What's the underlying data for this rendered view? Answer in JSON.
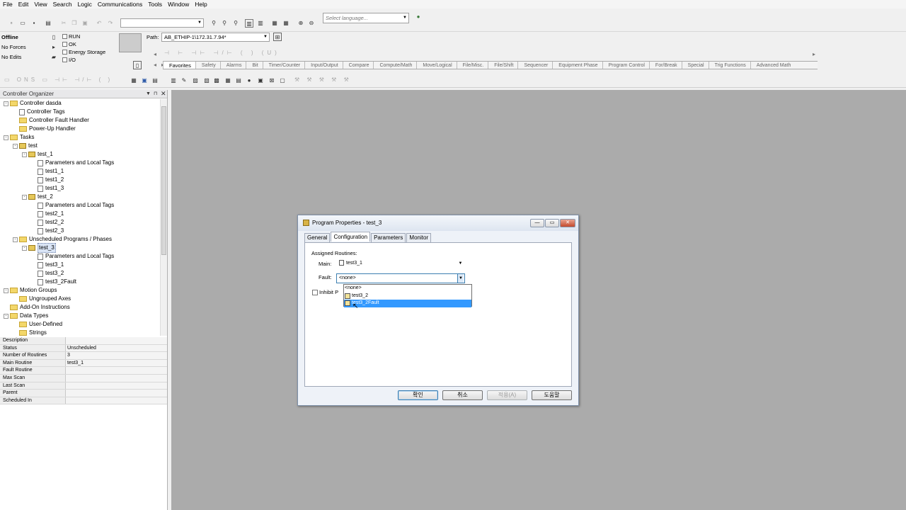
{
  "menu": [
    "File",
    "Edit",
    "View",
    "Search",
    "Logic",
    "Communications",
    "Tools",
    "Window",
    "Help"
  ],
  "toolbar": {
    "language_placeholder": "Select language...",
    "path_label": "Path:",
    "path_value": "AB_ETHIP-1\\172.31.7.94*"
  },
  "status": {
    "mode": "Offline",
    "forces": "No Forces",
    "edits": "No Edits",
    "indicators": [
      "RUN",
      "OK",
      "Energy Storage",
      "I/O"
    ]
  },
  "instruction_tabs": [
    "Favorites",
    "Safety",
    "Alarms",
    "Bit",
    "Timer/Counter",
    "Input/Output",
    "Compare",
    "Compute/Math",
    "Move/Logical",
    "File/Misc.",
    "File/Shift",
    "Sequencer",
    "Equipment Phase",
    "Program Control",
    "For/Break",
    "Special",
    "Trig Functions",
    "Advanced Math"
  ],
  "organizer": {
    "title": "Controller Organizer",
    "tree": [
      {
        "label": "Controller dasda",
        "level": 0,
        "icon": "folder",
        "exp": "-"
      },
      {
        "label": "Controller Tags",
        "level": 1,
        "icon": "tags"
      },
      {
        "label": "Controller Fault Handler",
        "level": 1,
        "icon": "folder"
      },
      {
        "label": "Power-Up Handler",
        "level": 1,
        "icon": "folder"
      },
      {
        "label": "Tasks",
        "level": 0,
        "icon": "folder",
        "exp": "-"
      },
      {
        "label": "test",
        "level": 1,
        "icon": "task",
        "exp": "-"
      },
      {
        "label": "test_1",
        "level": 2,
        "icon": "program",
        "exp": "-"
      },
      {
        "label": "Parameters and Local Tags",
        "level": 3,
        "icon": "tags"
      },
      {
        "label": "test1_1",
        "level": 3,
        "icon": "routine"
      },
      {
        "label": "test1_2",
        "level": 3,
        "icon": "routine"
      },
      {
        "label": "test1_3",
        "level": 3,
        "icon": "routine"
      },
      {
        "label": "test_2",
        "level": 2,
        "icon": "program",
        "exp": "-"
      },
      {
        "label": "Parameters and Local Tags",
        "level": 3,
        "icon": "tags"
      },
      {
        "label": "test2_1",
        "level": 3,
        "icon": "routine"
      },
      {
        "label": "test2_2",
        "level": 3,
        "icon": "routine"
      },
      {
        "label": "test2_3",
        "level": 3,
        "icon": "routine"
      },
      {
        "label": "Unscheduled Programs / Phases",
        "level": 1,
        "icon": "folder",
        "exp": "-"
      },
      {
        "label": "test_3",
        "level": 2,
        "icon": "program",
        "exp": "-",
        "selected": true
      },
      {
        "label": "Parameters and Local Tags",
        "level": 3,
        "icon": "tags"
      },
      {
        "label": "test3_1",
        "level": 3,
        "icon": "routine"
      },
      {
        "label": "test3_2",
        "level": 3,
        "icon": "routine"
      },
      {
        "label": "test3_2Fault",
        "level": 3,
        "icon": "routine"
      },
      {
        "label": "Motion Groups",
        "level": 0,
        "icon": "folder",
        "exp": "-"
      },
      {
        "label": "Ungrouped Axes",
        "level": 1,
        "icon": "folder"
      },
      {
        "label": "Add-On Instructions",
        "level": 0,
        "icon": "folder"
      },
      {
        "label": "Data Types",
        "level": 0,
        "icon": "folder",
        "exp": "-"
      },
      {
        "label": "User-Defined",
        "level": 1,
        "icon": "folder"
      },
      {
        "label": "Strings",
        "level": 1,
        "icon": "folder"
      }
    ],
    "properties": [
      {
        "key": "Description",
        "value": ""
      },
      {
        "key": "Status",
        "value": "Unscheduled"
      },
      {
        "key": "Number of Routines",
        "value": "3"
      },
      {
        "key": "Main Routine",
        "value": "test3_1"
      },
      {
        "key": "Fault Routine",
        "value": ""
      },
      {
        "key": "Max Scan",
        "value": ""
      },
      {
        "key": "Last Scan",
        "value": ""
      },
      {
        "key": "Parent",
        "value": ""
      },
      {
        "key": "Scheduled In",
        "value": ""
      }
    ]
  },
  "dialog": {
    "title": "Program Properties - test_3",
    "tabs": [
      "General",
      "Configuration",
      "Parameters",
      "Monitor"
    ],
    "active_tab": "Configuration",
    "assigned_label": "Assigned Routines:",
    "main_label": "Main:",
    "main_value": "test3_1",
    "fault_label": "Fault:",
    "fault_value": "<none>",
    "inhibit_label": "Inhibit P",
    "dropdown_options": [
      "<none>",
      "test3_2",
      "test3_2Fault"
    ],
    "highlighted_option": "test3_2Fault",
    "buttons": {
      "ok": "확인",
      "cancel": "취소",
      "apply": "적용(A)",
      "help": "도움말"
    }
  },
  "colors": {
    "workspace": "#ababab",
    "highlight": "#3399ff",
    "focus": "#3c7fb1"
  }
}
